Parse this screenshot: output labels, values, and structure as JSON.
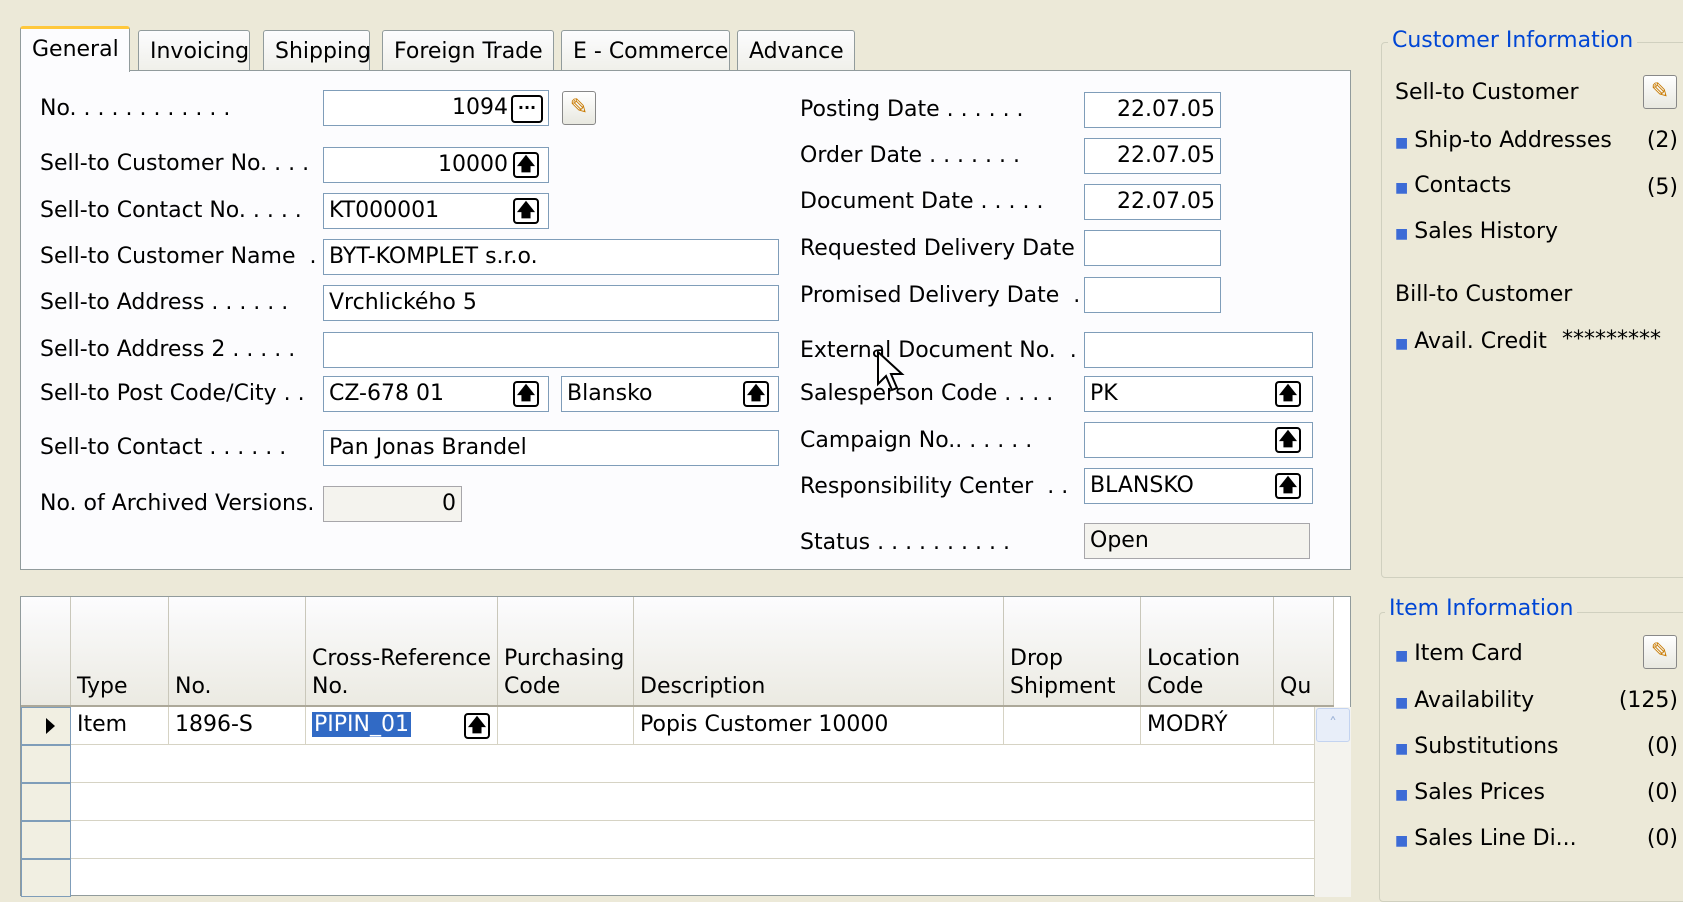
{
  "tabs": [
    "General",
    "Invoicing",
    "Shipping",
    "Foreign Trade",
    "E - Commerce",
    "Advance"
  ],
  "general": {
    "no_label": "No. . . . . . . . . . . .",
    "no_value": "1094",
    "sell_to_customer_no_label": "Sell-to Customer No. . . .",
    "sell_to_customer_no_value": "10000",
    "sell_to_contact_no_label": "Sell-to Contact No. . . . .",
    "sell_to_contact_no_value": "KT000001",
    "sell_to_customer_name_label": "Sell-to Customer Name  .",
    "sell_to_customer_name_value": "BYT-KOMPLET s.r.o.",
    "sell_to_address_label": "Sell-to Address . . . . . .",
    "sell_to_address_value": "Vrchlického 5",
    "sell_to_address2_label": "Sell-to Address 2 . . . . .",
    "sell_to_address2_value": "",
    "sell_to_post_code_city_label": "Sell-to Post Code/City . .",
    "sell_to_post_code_value": "CZ-678 01",
    "sell_to_city_value": "Blansko",
    "sell_to_contact_label": "Sell-to Contact . . . . . .",
    "sell_to_contact_value": "Pan Jonas Brandel",
    "archived_versions_label": "No. of Archived Versions.",
    "archived_versions_value": "0",
    "posting_date_label": "Posting Date . . . . . .",
    "posting_date_value": "22.07.05",
    "order_date_label": "Order Date . . . . . . .",
    "order_date_value": "22.07.05",
    "document_date_label": "Document Date . . . . .",
    "document_date_value": "22.07.05",
    "requested_delivery_label": "Requested Delivery Date",
    "requested_delivery_value": "",
    "promised_delivery_label": "Promised Delivery Date  .",
    "promised_delivery_value": "",
    "external_doc_label": "External Document No.  .",
    "external_doc_value": "",
    "salesperson_label": "Salesperson Code . . . .",
    "salesperson_value": "PK",
    "campaign_label": "Campaign No.. . . . . .",
    "campaign_value": "",
    "responsibility_label": "Responsibility Center  . .",
    "responsibility_value": "BLANSKO",
    "status_label": "Status . . . . . . . . . .",
    "status_value": "Open",
    "lookup_glyph": "🡅",
    "dots_glyph": "...",
    "pencil_glyph": "✎"
  },
  "lines": {
    "headers": [
      "Type",
      "No.",
      "Cross-Reference No.",
      "Purchasing Code",
      "Description",
      "Drop Shipment",
      "Location Code",
      "Qu"
    ],
    "rows": [
      {
        "type": "Item",
        "no": "1896-S",
        "cross_ref": "PIPIN_01",
        "purchasing": "",
        "description": "Popis Customer  10000",
        "drop": "",
        "location": "MODRÝ",
        "qty": ""
      }
    ]
  },
  "customer_info": {
    "title": "Customer Information",
    "sell_to_customer": "Sell-to Customer",
    "items": [
      {
        "label": "Ship-to Addresses",
        "count": "(2)"
      },
      {
        "label": "Contacts",
        "count": "(5)"
      },
      {
        "label": "Sales History",
        "count": ""
      }
    ],
    "bill_to_customer": "Bill-to Customer",
    "avail_credit_label": "Avail. Credit",
    "avail_credit_value": "*********"
  },
  "item_info": {
    "title": "Item Information",
    "items": [
      {
        "label": "Item Card",
        "count": ""
      },
      {
        "label": "Availability",
        "count": "(125)"
      },
      {
        "label": "Substitutions",
        "count": "(0)"
      },
      {
        "label": "Sales Prices",
        "count": "(0)"
      },
      {
        "label": "Sales Line Di...",
        "count": "(0)"
      }
    ]
  },
  "colors": {
    "accent": "#0046d5",
    "tab_highlight": "#ffc83c",
    "selection": "#316ac5",
    "background": "#ece9d8"
  }
}
